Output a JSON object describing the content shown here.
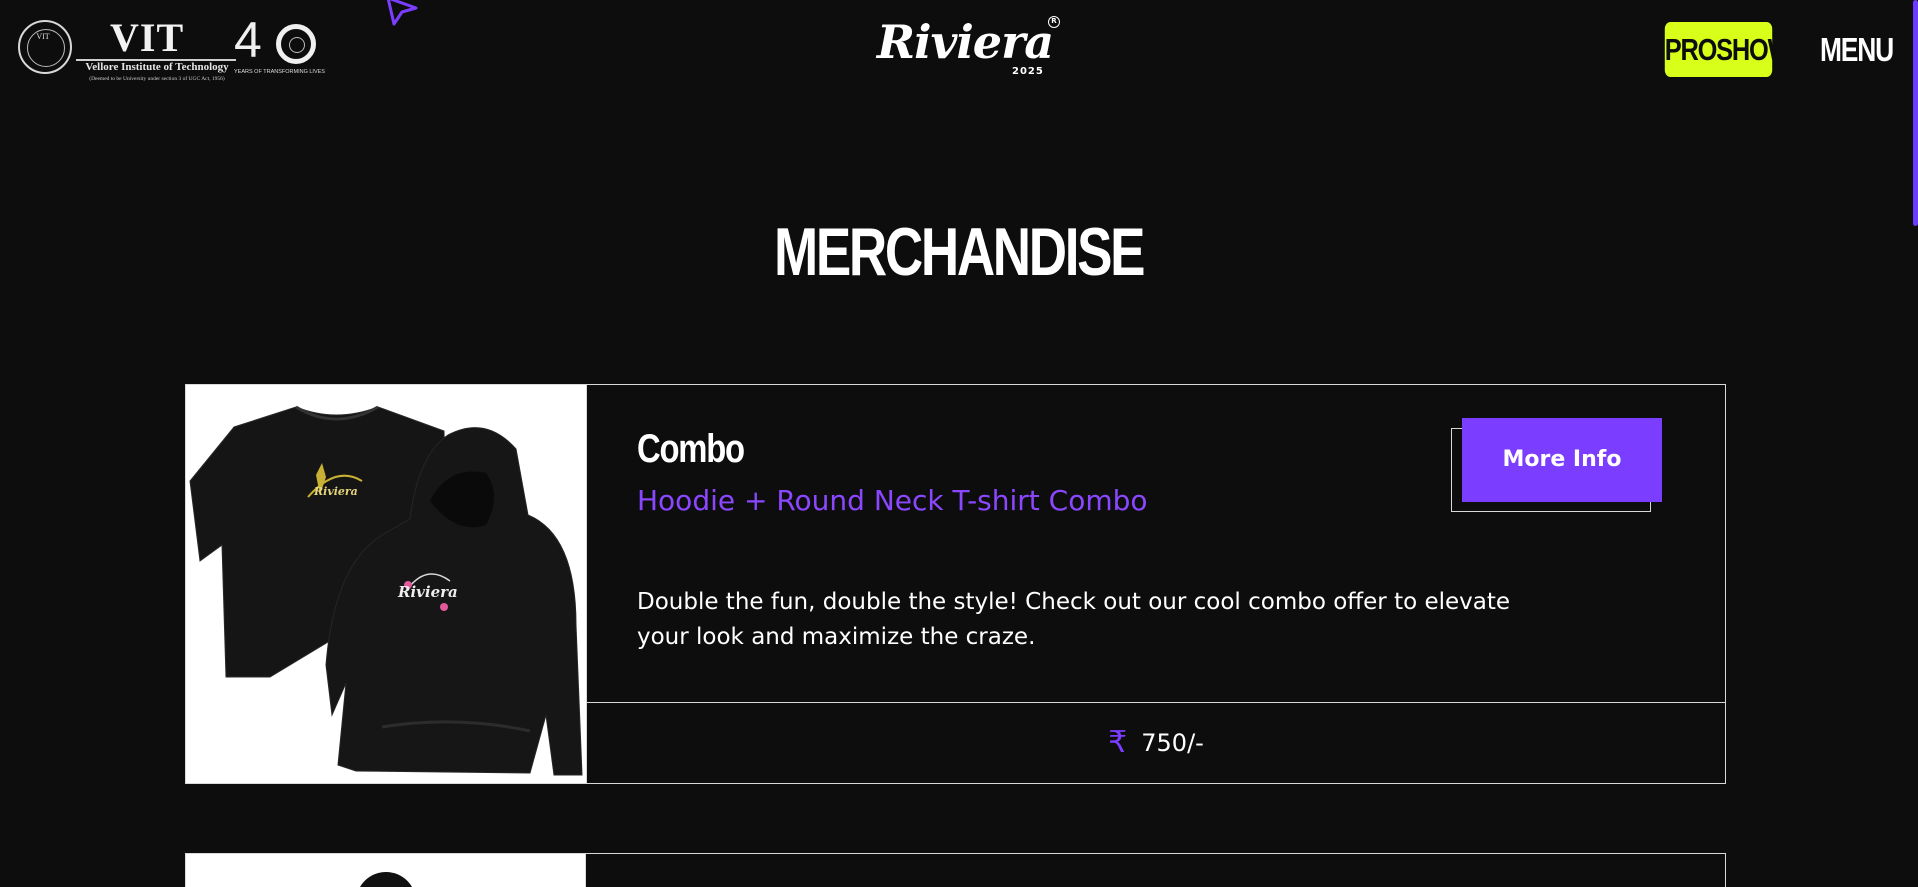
{
  "header": {
    "vit_logo": {
      "seal_text": "VIT",
      "wordmark": "VIT",
      "name": "Vellore Institute of Technology",
      "sub": "(Deemed to be University under section 3 of UGC Act, 1956)"
    },
    "anniversary_logo": {
      "number": "4",
      "sub": "YEARS OF TRANSFORMING LIVES"
    },
    "brand": {
      "wordmark": "Riviera",
      "registered": "R",
      "year": "2025"
    },
    "proshow_label": "PROSHOW",
    "menu_label": "MENU"
  },
  "page": {
    "title": "MERCHANDISE"
  },
  "products": [
    {
      "name": "Combo",
      "subtitle": "Hoodie + Round Neck T-shirt Combo",
      "description": "Double the fun, double the style! Check out our cool combo offer to elevate your look and maximize the craze.",
      "more_info_label": "More Info",
      "currency_icon": "rupee-icon",
      "price": "750/-",
      "image_print": "Riviera"
    }
  ],
  "colors": {
    "background": "#0d0d0e",
    "accent_purple": "#7b3dff",
    "subtitle_purple": "#8b47ff",
    "proshow_lime": "#d7ff19",
    "border": "#d9d9d9"
  }
}
